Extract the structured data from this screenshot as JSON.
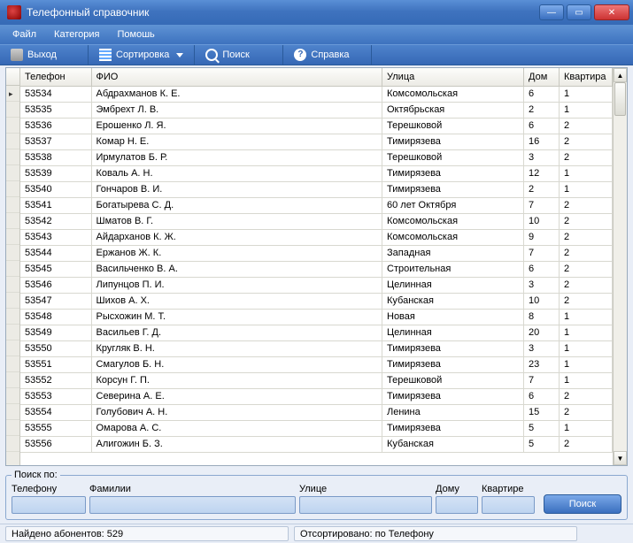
{
  "window": {
    "title": "Телефонный справочник"
  },
  "menubar": {
    "file": "Файл",
    "category": "Категория",
    "help": "Помошь"
  },
  "toolbar": {
    "exit": "Выход",
    "sort": "Сортировка",
    "search": "Поиск",
    "help": "Справка"
  },
  "columns": {
    "phone": "Телефон",
    "fio": "ФИО",
    "street": "Улица",
    "house": "Дом",
    "flat": "Квартира"
  },
  "rows": [
    {
      "phone": "53534",
      "fio": "Абдрахманов К. Е.",
      "street": "Комсомольская",
      "house": "6",
      "flat": "1"
    },
    {
      "phone": "53535",
      "fio": "Эмбрехт Л. В.",
      "street": "Октябрьская",
      "house": "2",
      "flat": "1"
    },
    {
      "phone": "53536",
      "fio": "Ерошенко Л. Я.",
      "street": "Терешковой",
      "house": "6",
      "flat": "2"
    },
    {
      "phone": "53537",
      "fio": "Комар Н. Е.",
      "street": "Тимирязева",
      "house": "16",
      "flat": "2"
    },
    {
      "phone": "53538",
      "fio": "Ирмулатов Б. Р.",
      "street": "Терешковой",
      "house": "3",
      "flat": "2"
    },
    {
      "phone": "53539",
      "fio": "Коваль А. Н.",
      "street": "Тимирязева",
      "house": "12",
      "flat": "1"
    },
    {
      "phone": "53540",
      "fio": "Гончаров В. И.",
      "street": "Тимирязева",
      "house": "2",
      "flat": "1"
    },
    {
      "phone": "53541",
      "fio": "Богатырева С. Д.",
      "street": "60 лет Октября",
      "house": "7",
      "flat": "2"
    },
    {
      "phone": "53542",
      "fio": "Шматов В. Г.",
      "street": "Комсомольская",
      "house": "10",
      "flat": "2"
    },
    {
      "phone": "53543",
      "fio": "Айдарханов К. Ж.",
      "street": "Комсомольская",
      "house": "9",
      "flat": "2"
    },
    {
      "phone": "53544",
      "fio": "Ержанов Ж. К.",
      "street": "Западная",
      "house": "7",
      "flat": "2"
    },
    {
      "phone": "53545",
      "fio": "Васильченко В. А.",
      "street": "Строительная",
      "house": "6",
      "flat": "2"
    },
    {
      "phone": "53546",
      "fio": "Липунцов П. И.",
      "street": "Целинная",
      "house": "3",
      "flat": "2"
    },
    {
      "phone": "53547",
      "fio": "Шихов А. Х.",
      "street": "Кубанская",
      "house": "10",
      "flat": "2"
    },
    {
      "phone": "53548",
      "fio": "Рысхожин М. Т.",
      "street": "Новая",
      "house": "8",
      "flat": "1"
    },
    {
      "phone": "53549",
      "fio": "Васильев Г. Д.",
      "street": "Целинная",
      "house": "20",
      "flat": "1"
    },
    {
      "phone": "53550",
      "fio": "Кругляк В. Н.",
      "street": "Тимирязева",
      "house": "3",
      "flat": "1"
    },
    {
      "phone": "53551",
      "fio": "Смагулов Б. Н.",
      "street": "Тимирязева",
      "house": "23",
      "flat": "1"
    },
    {
      "phone": "53552",
      "fio": "Корсун Г. П.",
      "street": "Терешковой",
      "house": "7",
      "flat": "1"
    },
    {
      "phone": "53553",
      "fio": "Северина А. Е.",
      "street": "Тимирязева",
      "house": "6",
      "flat": "2"
    },
    {
      "phone": "53554",
      "fio": "Голубович А. Н.",
      "street": "Ленина",
      "house": "15",
      "flat": "2"
    },
    {
      "phone": "53555",
      "fio": "Омарова А. С.",
      "street": "Тимирязева",
      "house": "5",
      "flat": "1"
    },
    {
      "phone": "53556",
      "fio": "Алигожин Б. З.",
      "street": "Кубанская",
      "house": "5",
      "flat": "2"
    }
  ],
  "search": {
    "legend": "Поиск по:",
    "phone_label": "Телефону",
    "surname_label": "Фамилии",
    "street_label": "Улице",
    "house_label": "Дому",
    "flat_label": "Квартире",
    "button": "Поиск"
  },
  "status": {
    "found_label": "Найдено абонентов:",
    "found_count": "529",
    "sorted_label": "Отсортировано:",
    "sorted_by": "по Телефону"
  }
}
